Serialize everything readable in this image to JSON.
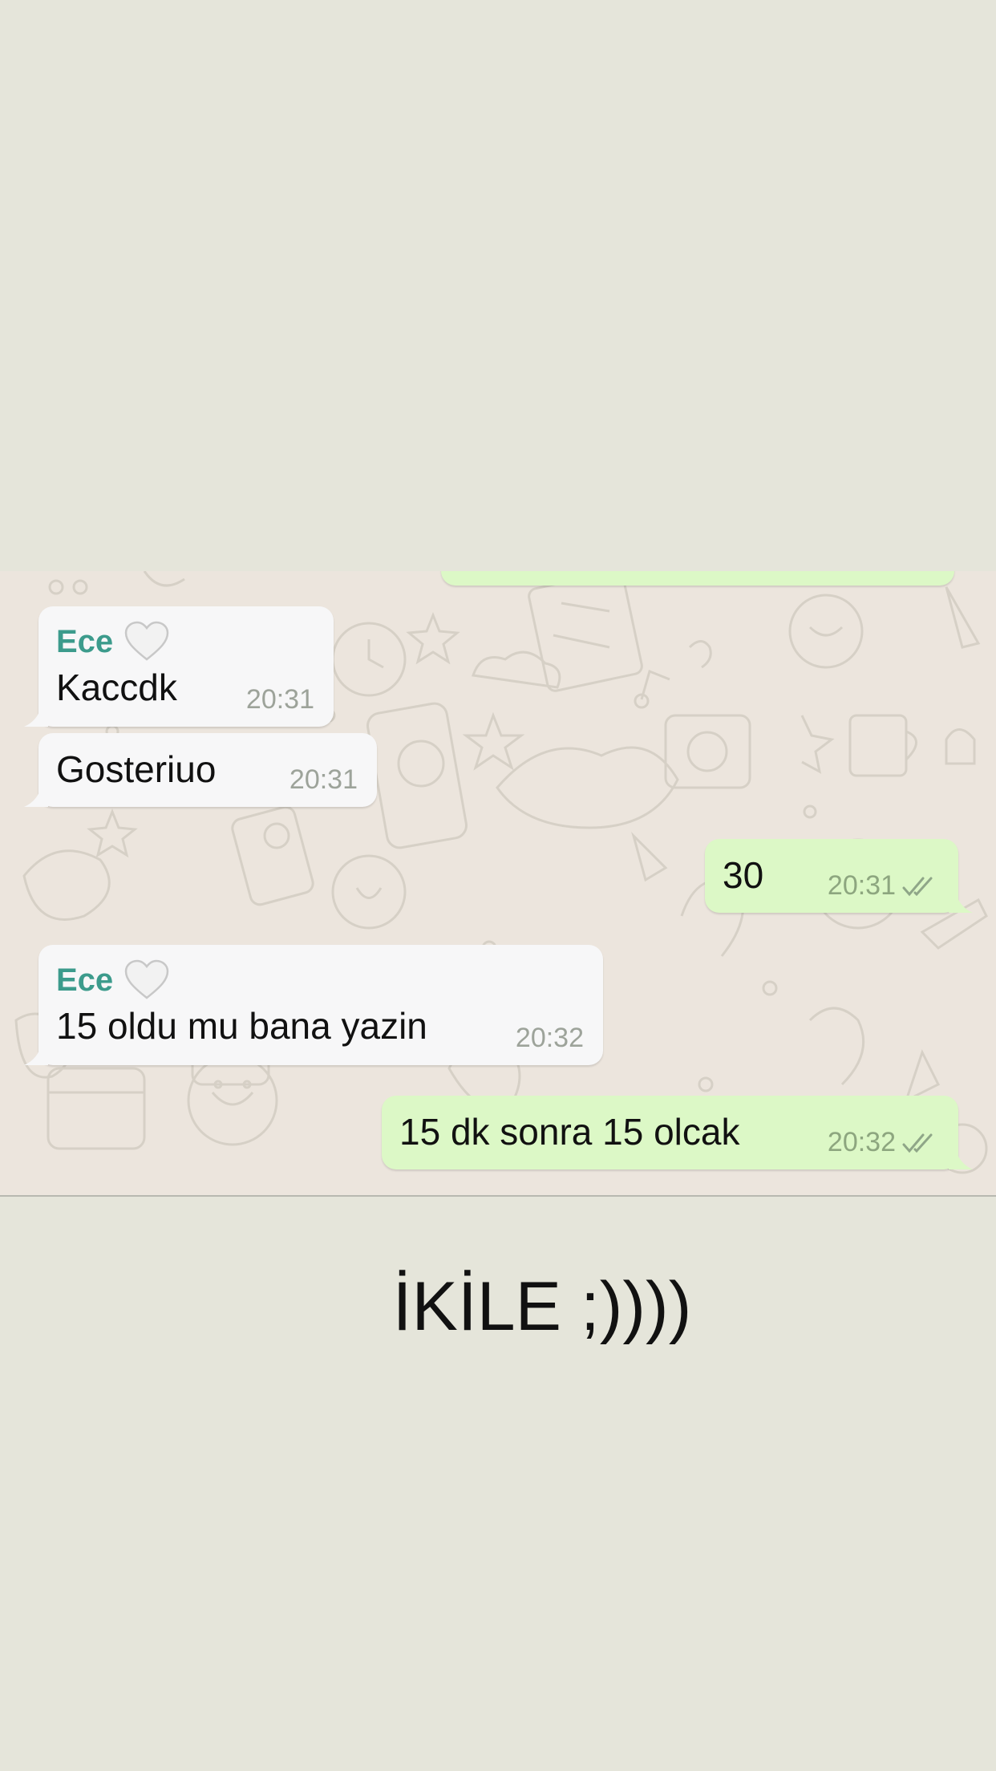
{
  "messages": [
    {
      "direction": "incoming",
      "sender": "Ece",
      "sender_icon": "white-heart-icon",
      "text": "Kaccdk",
      "time": "20:31"
    },
    {
      "direction": "incoming",
      "text": "Gosteriuo",
      "time": "20:31"
    },
    {
      "direction": "outgoing",
      "text": "30",
      "time": "20:31",
      "status_icon": "double-check-icon"
    },
    {
      "direction": "incoming",
      "sender": "Ece",
      "sender_icon": "white-heart-icon",
      "text": "15 oldu mu bana yazin",
      "time": "20:32"
    },
    {
      "direction": "outgoing",
      "text": "15 dk sonra 15 olcak",
      "time": "20:32",
      "status_icon": "double-check-icon"
    }
  ],
  "caption": "İKİLE ;))))",
  "colors": {
    "page_background": "#e5e5da",
    "chat_background": "#ece5dd",
    "incoming_bubble": "#f7f7f8",
    "outgoing_bubble": "#dcf8c6",
    "sender_name": "#3c9b8c"
  }
}
